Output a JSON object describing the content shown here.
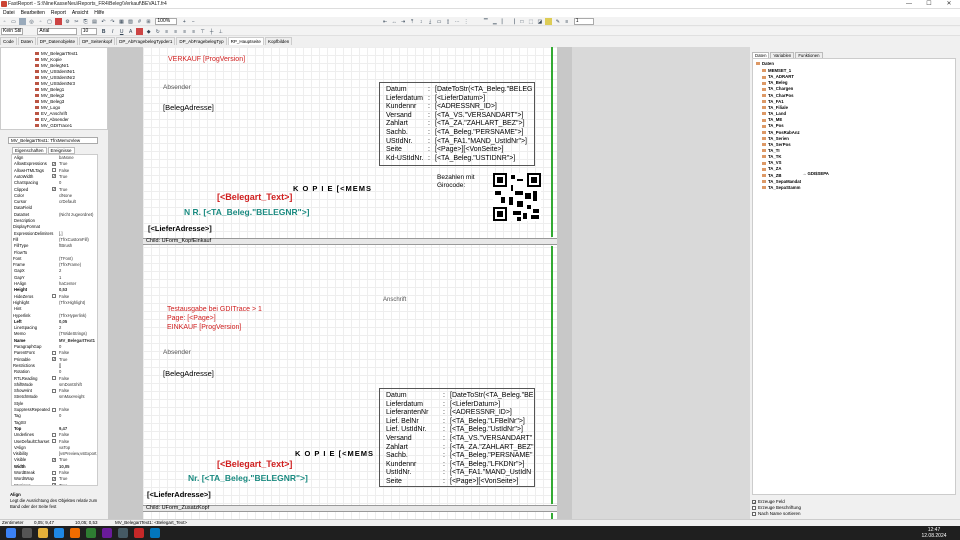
{
  "window": {
    "title": "FastReport - S:\\NineKasseNeu\\Reports_FR4\\Beleg\\Verkauf\\BEVALT.fr4",
    "minimize": "—",
    "maximize": "☐",
    "close": "✕"
  },
  "menu": [
    "Datei",
    "Bearbeiten",
    "Report",
    "Ansicht",
    "Hilfe"
  ],
  "toolbar": {
    "zoom": "100%",
    "font_name": "Arial",
    "font_size": "10",
    "style_name": "Kein Stil",
    "frame_width": "1"
  },
  "tabs": [
    "Code",
    "Daten",
    "DP_Datenobjekte",
    "DP_Seitenkopf",
    "DP_AbFragebelegTypder1",
    "DP_AbFragebelegTyp",
    "RP_Hauptseite",
    "Kopfbilden"
  ],
  "object_tree": [
    "MV_BelegartText1",
    "MV_Kopie",
    "MV_BelegNr1",
    "MV_UStIdentNr1",
    "MV_UStIdentNr2",
    "MV_UStIdentNr3",
    "MV_Beleg1",
    "MV_Beleg2",
    "MV_Beleg3",
    "MV_Logo",
    "EV_Anschrift",
    "EV_Absender",
    "MV_GDITrace1"
  ],
  "object_selector": "MV_BelegartText1: TfrxMemoView",
  "prop_tabs": [
    "Eigenschaften",
    "Ereignisse"
  ],
  "properties": [
    {
      "k": "Align",
      "v": "baNone"
    },
    {
      "k": "AllowExpressions",
      "v": "True",
      "cb": true
    },
    {
      "k": "AllowHTMLTags",
      "v": "False",
      "cb": true
    },
    {
      "k": "AutoWidth",
      "v": "True",
      "cb": true
    },
    {
      "k": "CharSpacing",
      "v": "0"
    },
    {
      "k": "Clipped",
      "v": "True",
      "cb": true
    },
    {
      "k": "Color",
      "v": "clNone"
    },
    {
      "k": "Cursor",
      "v": "crDefault"
    },
    {
      "k": "DataField",
      "v": ""
    },
    {
      "k": "DataSet",
      "v": "(Nicht zugeordnet)"
    },
    {
      "k": "Description",
      "v": ""
    },
    {
      "k": "DisplayFormat",
      "v": "",
      "sec": true
    },
    {
      "k": "ExpressionDelimiters",
      "v": "[,]"
    },
    {
      "k": "Fill",
      "v": "(TfrxCustomFill)",
      "sec": true
    },
    {
      "k": "FillType",
      "v": "ftBrush"
    },
    {
      "k": "FlowTo",
      "v": ""
    },
    {
      "k": "Font",
      "v": "(TFont)",
      "sec": true
    },
    {
      "k": "Frame",
      "v": "(TfrxFrame)",
      "sec": true
    },
    {
      "k": "GapX",
      "v": "2"
    },
    {
      "k": "GapY",
      "v": "1"
    },
    {
      "k": "HAlign",
      "v": "haCenter"
    },
    {
      "k": "Height",
      "v": "0,53",
      "bold": true
    },
    {
      "k": "HideZeros",
      "v": "False",
      "cb": true
    },
    {
      "k": "Highlight",
      "v": "(TfrxHighlight)",
      "sec": true
    },
    {
      "k": "Hint",
      "v": ""
    },
    {
      "k": "Hyperlink",
      "v": "(TfrxHyperlink)",
      "sec": true
    },
    {
      "k": "Left",
      "v": "0,05",
      "bold": true
    },
    {
      "k": "LineSpacing",
      "v": "2"
    },
    {
      "k": "Memo",
      "v": "(TWideStrings)"
    },
    {
      "k": "Name",
      "v": "MV_BelegartText1",
      "bold": true
    },
    {
      "k": "ParagraphGap",
      "v": "0"
    },
    {
      "k": "ParentFont",
      "v": "False",
      "cb": true
    },
    {
      "k": "Printable",
      "v": "True",
      "cb": true
    },
    {
      "k": "Restrictions",
      "v": "[]",
      "sec": true
    },
    {
      "k": "Rotation",
      "v": "0"
    },
    {
      "k": "RTLReading",
      "v": "False",
      "cb": true
    },
    {
      "k": "ShiftMode",
      "v": "smDontShift"
    },
    {
      "k": "ShowHint",
      "v": "False",
      "cb": true
    },
    {
      "k": "StretchMode",
      "v": "smMaxHeight"
    },
    {
      "k": "Style",
      "v": ""
    },
    {
      "k": "SuppressRepeated",
      "v": "False",
      "cb": true
    },
    {
      "k": "Tag",
      "v": "0"
    },
    {
      "k": "TagStr",
      "v": ""
    },
    {
      "k": "Top",
      "v": "9,47",
      "bold": true
    },
    {
      "k": "Underlines",
      "v": "False",
      "cb": true
    },
    {
      "k": "UseDefaultCharset",
      "v": "False",
      "cb": true
    },
    {
      "k": "VAlign",
      "v": "vaTop"
    },
    {
      "k": "Visibility",
      "v": "[vsPreview,vsExport,",
      "sec": true
    },
    {
      "k": "Visible",
      "v": "True",
      "cb": true
    },
    {
      "k": "Width",
      "v": "10,05",
      "bold": true
    },
    {
      "k": "WordBreak",
      "v": "False",
      "cb": true
    },
    {
      "k": "WordWrap",
      "v": "True",
      "cb": true
    },
    {
      "k": "Wysiwyg",
      "v": "True",
      "cb": true
    }
  ],
  "help": {
    "title": "Align",
    "text": "Legt die Ausrichtung des Objektes relativ zum Band oder der Seite fest"
  },
  "status": {
    "units": "Zentimeter",
    "pos1": "0,05; 9,47",
    "pos2": "10,05; 0,53",
    "object": "MV_BelegartText1: <Belegart_Text>"
  },
  "page": {
    "upper": {
      "verkauf": "VERKAUF  [ProgVersion]",
      "absender": "Absender",
      "belegadresse": "[BelegAdresse]",
      "belegart": "[<Belegart_Text>]",
      "kopie": "K O P I E    [<MEMS",
      "belegnr": "N R.  [<TA_Beleg.\"BELEGNR\">]",
      "lieferadresse": "[<LieferAdresse>]",
      "girocode": "Bezahlen mit Girocode:",
      "info_labels": [
        "Datum",
        "Lieferdatum",
        "Kundennr",
        "Versand",
        "Zahlart",
        "Sachb.",
        "UStIdNr.",
        "Seite",
        "Kd-UStIdNr."
      ],
      "info_values": [
        "[DateToStr(<TA_Beleg.\"BELEG",
        "[<LieferDatum>]",
        "[<ADRESSNR_ID>]",
        "[<TA_VS.\"VERSANDART\">]",
        "[<TA_ZA.\"ZAHLART_BEZ\">]",
        "[<TA_Beleg.\"PERSNAME\">]",
        "[<TA_FA1.\"MAND_UstIdNr\">]",
        "[<Page>][<VonSeite>]",
        "[<TA_Beleg.\"USTIDNR\">]"
      ]
    },
    "band1": "Child: UForm_KopfEinkauf",
    "lower": {
      "trace": "Testausgabe bei GDITrace > 1",
      "pagenum": "Page: [<Page>]",
      "einkauf": "EINKAUF  [ProgVersion]",
      "anschrift": "Anschrift",
      "absender": "Absender",
      "belegadresse": "[BelegAdresse]",
      "kopie": "K O P I E    [<MEMS",
      "belegart": "[<Belegart_Text>]",
      "belegnr": "Nr.  [<TA_Beleg.\"BELEGNR\">]",
      "lieferadresse": "[<LieferAdresse>]",
      "info_labels": [
        "Datum",
        "Lieferdatum",
        "LieferantenNr",
        "Lief. BelNr",
        "Lief. UstIdNr.",
        "Versand",
        "Zahlart",
        "Sachb.",
        "Kundennr",
        "UstIdNr.",
        "Seite"
      ],
      "info_values": [
        "[DateToStr(<TA_Beleg.\"BE",
        "[<LieferDatum>]",
        "[<ADRESSNR_ID>]",
        "[<TA_Beleg.\"LFBelNr\">]",
        "[<TA_Beleg.\"UstIdNr\">]",
        "[<TA_VS.\"VERSANDART\"",
        "[<TA_ZA.\"ZAHLART_BEZ\"",
        "[<TA_Beleg.\"PERSNAME\"",
        "[<TA_Beleg.\"LFKDNr\">]",
        "[<TA_FA1.\"MAND_UstIdN",
        "[<Page>][<VonSeite>]"
      ]
    },
    "band2": "Child: UForm_ZusatzKopf"
  },
  "data_tabs": [
    "Daten",
    "Variablen",
    "Funktionen",
    "Klassen"
  ],
  "data_tree": {
    "root": "Daten",
    "items": [
      "MEMSET_1",
      "TA_ADRART",
      "TA_Beleg",
      "TA_Chargen",
      "TA_CharPos",
      "TA_FA1",
      "TA_Filiale",
      "TA_Land",
      "TA_ME",
      "TA_Pos",
      "TA_PosRabAnz",
      "TA_Serien",
      "TA_SerPos",
      "TA_TI",
      "TA_TK",
      "TA_VS",
      "TA_ZA",
      "TA_ZB",
      "TA_SepaMandat",
      "TA_SepaStamm"
    ],
    "sepa_link": "→ GDI$SEPA"
  },
  "options": [
    {
      "label": "Erzeuge Feld",
      "checked": true
    },
    {
      "label": "Erzeuge Beschriftung",
      "checked": false
    },
    {
      "label": "Nach Name sortieren",
      "checked": false
    }
  ],
  "clock": {
    "time": "12:47",
    "date": "12.08.2024"
  },
  "colors": {
    "accent_red": "#d02020",
    "accent_teal": "#1a8a80",
    "band_green": "#33aa33"
  }
}
